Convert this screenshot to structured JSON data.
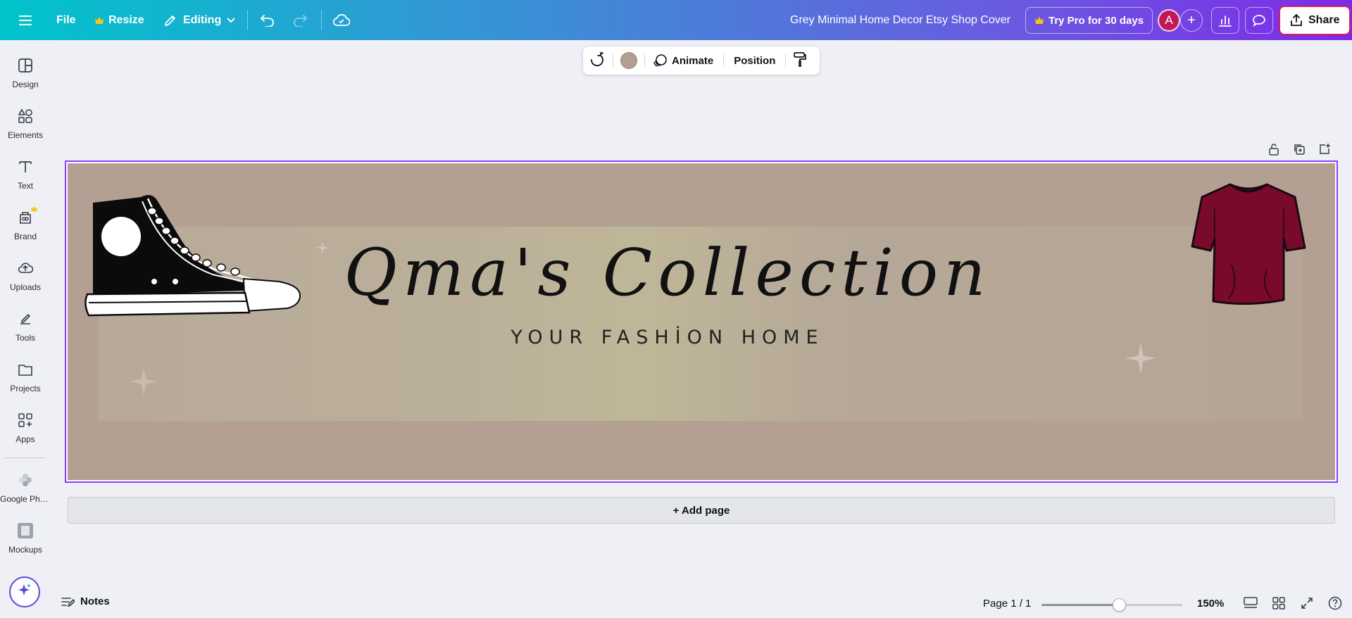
{
  "topbar": {
    "file_label": "File",
    "resize_label": "Resize",
    "editing_label": "Editing",
    "document_title": "Grey Minimal Home Decor Etsy Shop Cover",
    "try_pro_label": "Try Pro for 30 days",
    "avatar_initial": "A",
    "share_label": "Share",
    "crown_color": "#f5c518"
  },
  "sidebar": {
    "items": [
      {
        "label": "Design",
        "icon": "design-icon"
      },
      {
        "label": "Elements",
        "icon": "elements-icon"
      },
      {
        "label": "Text",
        "icon": "text-icon"
      },
      {
        "label": "Brand",
        "icon": "brand-icon"
      },
      {
        "label": "Uploads",
        "icon": "uploads-icon"
      },
      {
        "label": "Tools",
        "icon": "tools-icon"
      },
      {
        "label": "Projects",
        "icon": "projects-icon"
      },
      {
        "label": "Apps",
        "icon": "apps-icon"
      },
      {
        "label": "Google Pho...",
        "icon": "google-photos-icon"
      },
      {
        "label": "Mockups",
        "icon": "mockups-icon"
      }
    ]
  },
  "context_toolbar": {
    "swatch_color": "#b3a092",
    "animate_label": "Animate",
    "position_label": "Position"
  },
  "design": {
    "background_color": "#b3a092",
    "title": "Qma's Collection",
    "subtitle": "YOUR FASHİON HOME",
    "tshirt_color": "#7a0a2c"
  },
  "add_page_label": "+  Add page",
  "bottombar": {
    "notes_label": "Notes",
    "page_indicator": "Page 1 / 1",
    "zoom_level": "150%",
    "zoom_slider_fraction": 0.55
  }
}
